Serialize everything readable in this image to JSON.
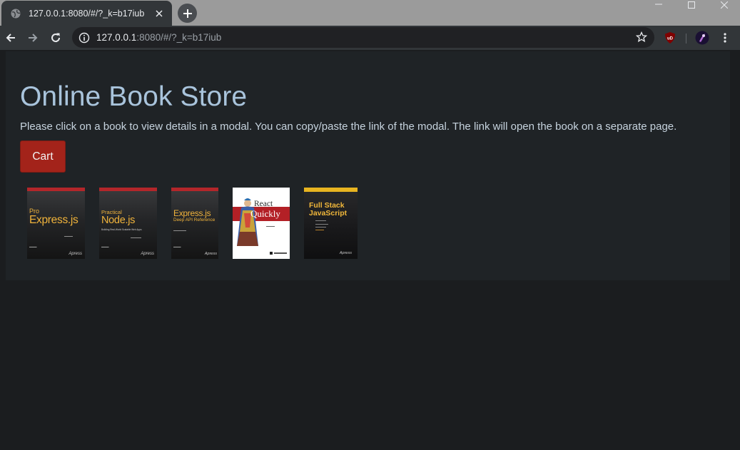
{
  "browser": {
    "tab_title": "127.0.0.1:8080/#/?_k=b17iub",
    "url_host": "127.0.0.1",
    "url_rest": ":8080/#/?_k=b17iub",
    "extension_label": "uD"
  },
  "page": {
    "title": "Online Book Store",
    "description": "Please click on a book to view details in a modal. You can copy/paste the link of the modal. The link will open the book on a separate page.",
    "cart_label": "Cart"
  },
  "books": [
    {
      "title_line1": "Pro",
      "title_line2": "Express.js",
      "publisher": "Apress"
    },
    {
      "title_line1": "Practical",
      "title_line2": "Node.js",
      "subtitle": "Building Real-World Scalable Web Apps",
      "publisher": "Apress"
    },
    {
      "title_line1": "Express.js",
      "title_line2": "Deep API Reference",
      "publisher": "Apress"
    },
    {
      "title_line1": "React",
      "title_line2": "Quickly"
    },
    {
      "title_line1": "Full Stack",
      "title_line2": "JavaScript",
      "publisher": "Apress"
    }
  ],
  "colors": {
    "cart_button": "#a3231a",
    "title": "#a9c4dc",
    "panel": "#1f2326",
    "cover_accent": "#f0b33b"
  }
}
